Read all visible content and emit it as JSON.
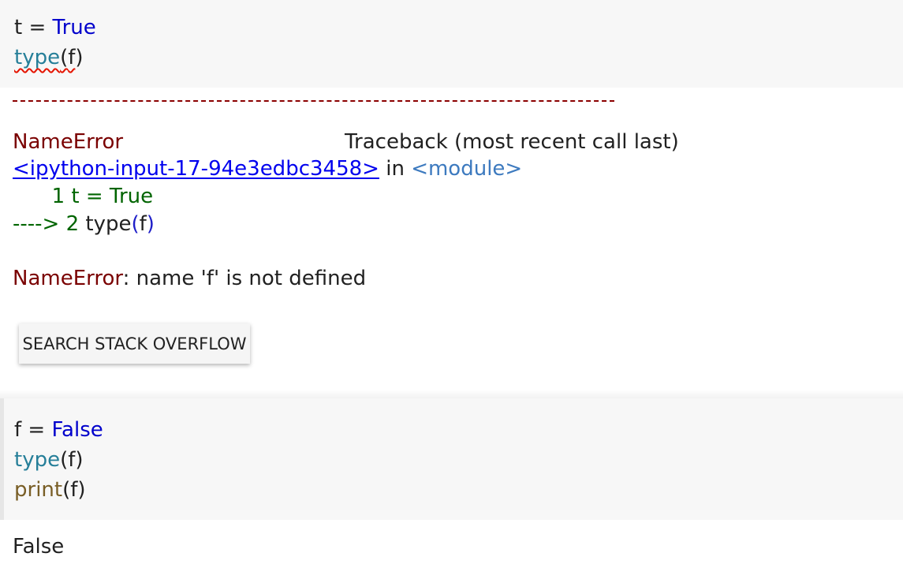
{
  "cell1": {
    "line1": {
      "var": "t",
      "op": " = ",
      "value": "True"
    },
    "line2": {
      "func": "type",
      "open": "(",
      "arg": "f",
      "close": ")"
    }
  },
  "traceback": {
    "dashes": "",
    "error_name": "NameError",
    "header": "Traceback (most recent call last)",
    "input_link": "<ipython-input-17-94e3edbc3458>",
    "in_word": " in ",
    "module": "<module>",
    "line1_prefix": "      1 ",
    "line1_code": "t = True",
    "line2_arrow": "----> 2 ",
    "line2_func": "type",
    "line2_open": "(",
    "line2_arg": "f",
    "line2_close": ")",
    "final_error": "NameError",
    "final_message": ": name 'f' is not defined",
    "search_button": "SEARCH STACK OVERFLOW"
  },
  "cell2": {
    "line1": {
      "var": "f",
      "op": " = ",
      "value": "False"
    },
    "line2": {
      "func": "type",
      "open": "(",
      "arg": "f",
      "close": ")"
    },
    "line3": {
      "func": "print",
      "open": "(",
      "arg": "f",
      "close": ")"
    }
  },
  "output2": {
    "text": "False"
  }
}
